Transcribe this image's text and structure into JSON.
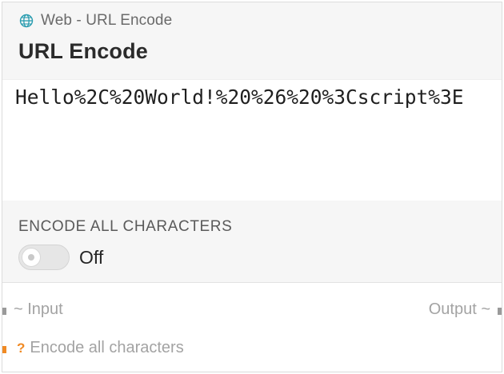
{
  "header": {
    "category": "Web - URL Encode",
    "category_icon": "globe-icon",
    "title": "URL Encode"
  },
  "output": {
    "value": "Hello%2C%20World!%20%26%20%3Cscript%3E"
  },
  "config": {
    "field_label": "ENCODE ALL CHARACTERS",
    "toggle_state": "Off",
    "toggle_on": false
  },
  "ports": {
    "input_label": "~ Input",
    "output_label": "Output ~",
    "param_marker": "?",
    "param_label": "Encode all characters"
  },
  "colors": {
    "accent_icon": "#2a9db0",
    "param_handle": "#f08a24",
    "port_handle": "#9a9a9a"
  }
}
